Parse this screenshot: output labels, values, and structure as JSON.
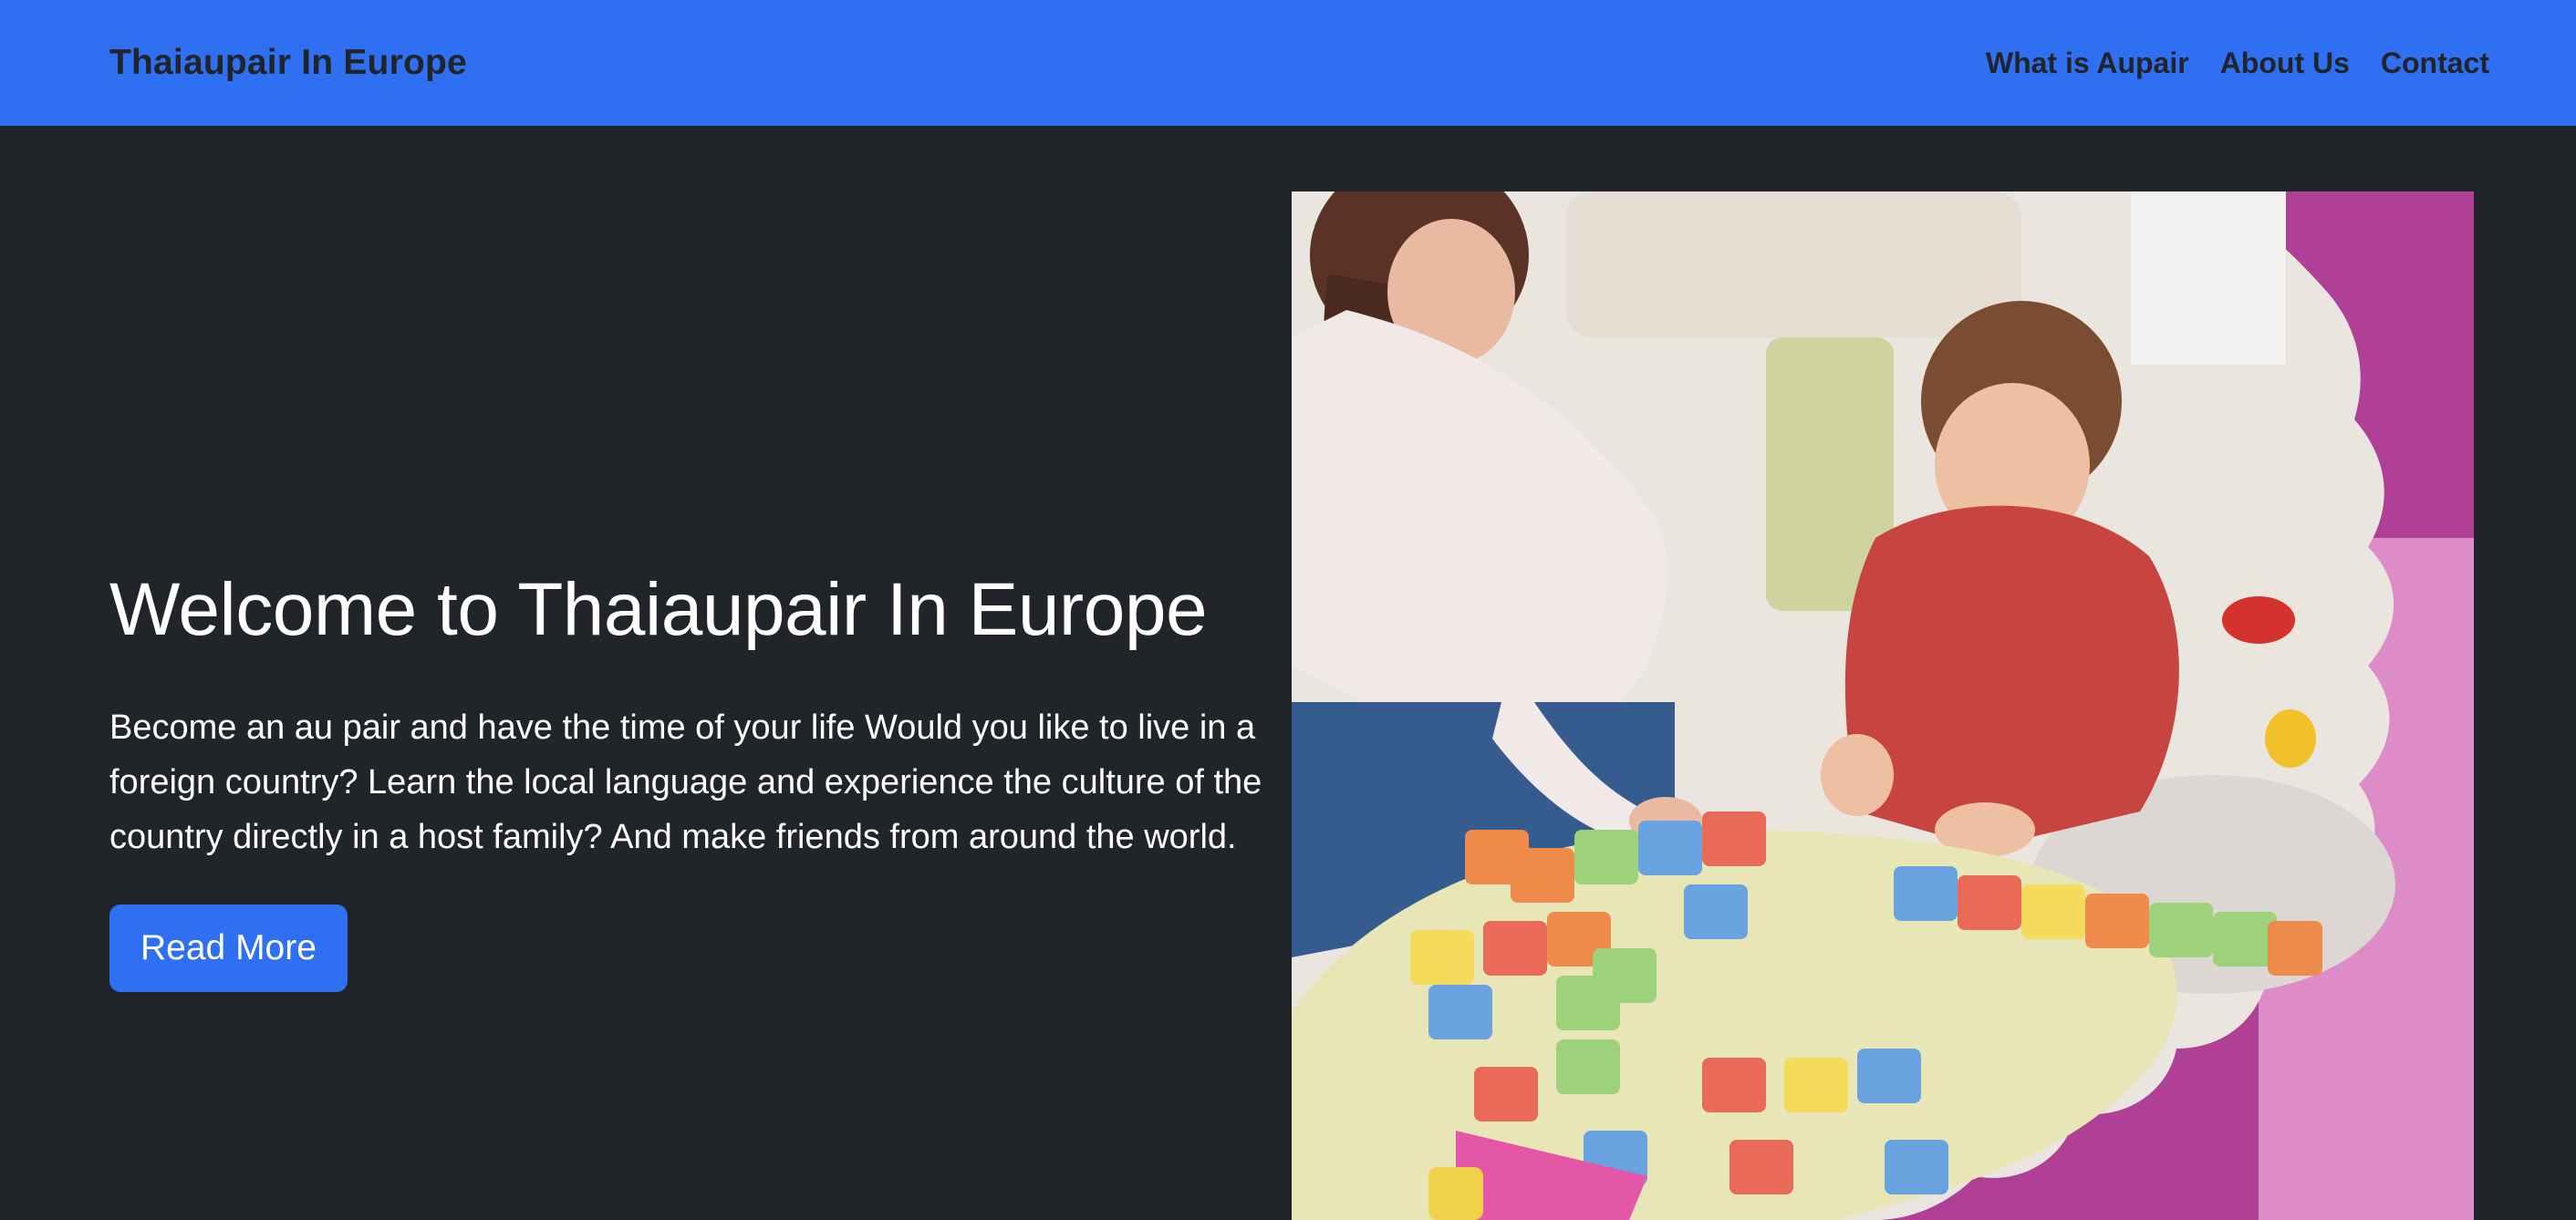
{
  "navbar": {
    "brand": "Thaiaupair In Europe",
    "links": [
      {
        "label": "What is Aupair"
      },
      {
        "label": "About Us"
      },
      {
        "label": "Contact"
      }
    ]
  },
  "hero": {
    "title": "Welcome to Thaiaupair In Europe",
    "lead": "Become an au pair and have the time of your life Would you like to live in a foreign country? Learn the local language and experience the culture of the country directly in a host family? And make friends from around the world.",
    "button_label": "Read More",
    "image_description_icon": "photo-au-pair-playing-with-child"
  },
  "colors": {
    "primary": "#2f6ff2",
    "background": "#212529",
    "text": "#ffffff"
  }
}
